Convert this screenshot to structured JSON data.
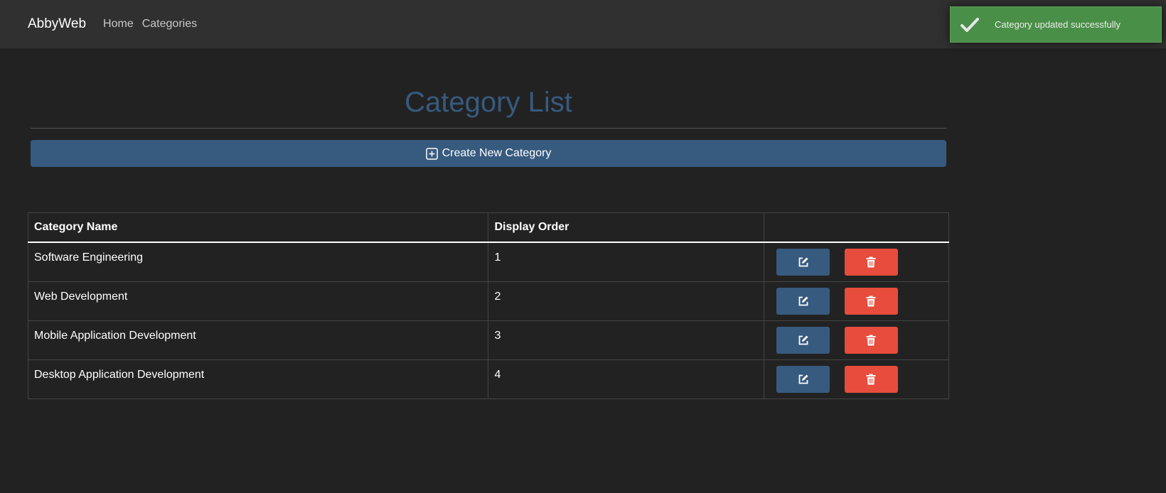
{
  "navbar": {
    "brand": "AbbyWeb",
    "links": [
      {
        "label": "Home"
      },
      {
        "label": "Categories"
      }
    ]
  },
  "toast": {
    "message": "Category updated successfully",
    "icon": "checkmark-icon",
    "color": "#4a8f48"
  },
  "page": {
    "title": "Category List",
    "create_button_label": "Create New Category",
    "create_button_icon": "plus-square-icon"
  },
  "table": {
    "headers": [
      "Category Name",
      "Display Order",
      ""
    ],
    "rows": [
      {
        "name": "Software Engineering",
        "order": "1"
      },
      {
        "name": "Web Development",
        "order": "2"
      },
      {
        "name": "Mobile Application Development",
        "order": "3"
      },
      {
        "name": "Desktop Application Development",
        "order": "4"
      }
    ],
    "edit_icon": "edit-icon",
    "delete_icon": "trash-icon"
  },
  "colors": {
    "primary": "#375a7f",
    "danger": "#e74c3c",
    "success": "#4a8f48",
    "background": "#222222",
    "navbar": "#303030"
  }
}
